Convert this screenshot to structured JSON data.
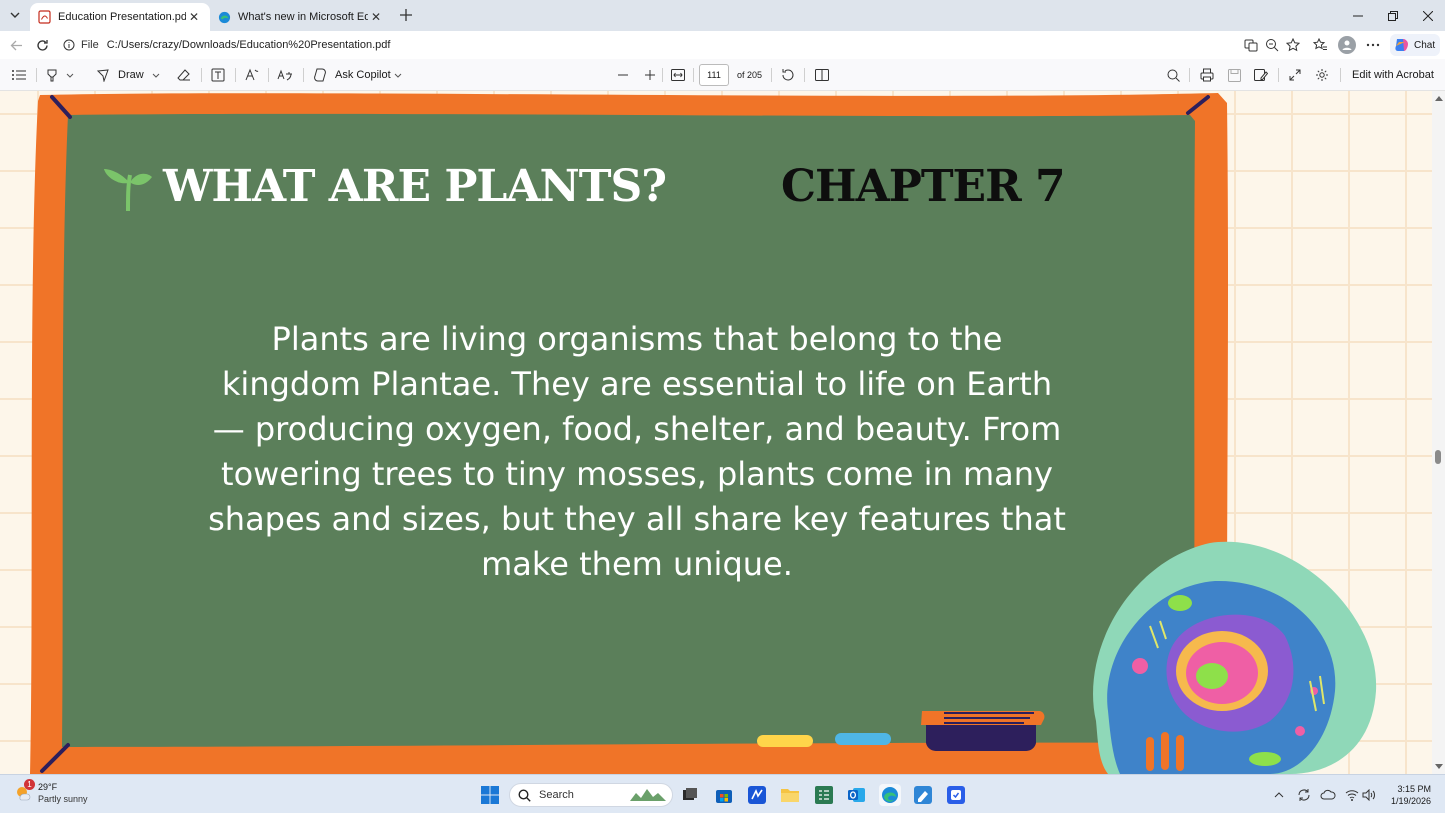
{
  "browser": {
    "tabs": [
      {
        "label": "Education Presentation.pdf",
        "active": true,
        "icon": "pdf-icon"
      },
      {
        "label": "What's new in Microsoft Edge",
        "active": false,
        "icon": "edge-icon"
      }
    ],
    "address": {
      "scheme_label": "File",
      "url": "C:/Users/crazy/Downloads/Education%20Presentation.pdf"
    },
    "chat_label": "Chat"
  },
  "pdf_toolbar": {
    "draw_label": "Draw",
    "copilot_label": "Ask Copilot",
    "page_current": "111",
    "page_total": "of 205",
    "edit_label": "Edit with Acrobat"
  },
  "slide": {
    "title": "WHAT ARE PLANTS?",
    "chapter": "CHAPTER 7",
    "body": "Plants are living organisms that belong to the kingdom Plantae. They are essential to life on Earth — producing oxygen, food, shelter, and beauty. From towering trees to tiny mosses, plants come in many shapes and sizes, but they all share key features that make them unique.",
    "colors": {
      "board": "#5b7f5a",
      "frame": "#f07428",
      "background": "#fdf6ea"
    }
  },
  "taskbar": {
    "weather_temp": "29°F",
    "weather_desc": "Partly sunny",
    "weather_badge": "1",
    "search_placeholder": "Search",
    "time": "3:15 PM",
    "date": "1/19/2026"
  }
}
